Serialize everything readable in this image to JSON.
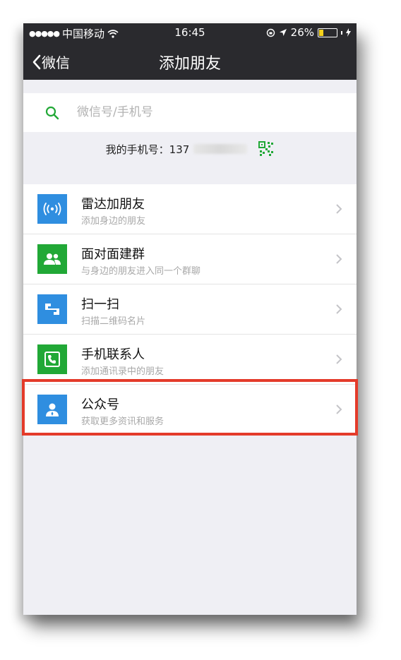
{
  "status_bar": {
    "carrier": "中国移动",
    "time": "16:45",
    "battery": "26%",
    "battery_level": 0.26
  },
  "nav": {
    "back_label": "微信",
    "title": "添加朋友"
  },
  "search": {
    "placeholder": "微信号/手机号"
  },
  "my_phone": {
    "label": "我的手机号：137"
  },
  "list": {
    "items": [
      {
        "title": "雷达加朋友",
        "subtitle": "添加身边的朋友",
        "icon": "radar-icon",
        "color": "#2f8ee0"
      },
      {
        "title": "面对面建群",
        "subtitle": "与身边的朋友进入同一个群聊",
        "icon": "group-icon",
        "color": "#21a836"
      },
      {
        "title": "扫一扫",
        "subtitle": "扫描二维码名片",
        "icon": "scan-icon",
        "color": "#2f8ee0"
      },
      {
        "title": "手机联系人",
        "subtitle": "添加通讯录中的朋友",
        "icon": "phone-contact-icon",
        "color": "#21a836"
      },
      {
        "title": "公众号",
        "subtitle": "获取更多资讯和服务",
        "icon": "official-account-icon",
        "color": "#2f8ee0"
      }
    ]
  },
  "colors": {
    "nav_bg": "#2a2a2e",
    "accent_green": "#21a836",
    "highlight": "#e43b2a"
  }
}
